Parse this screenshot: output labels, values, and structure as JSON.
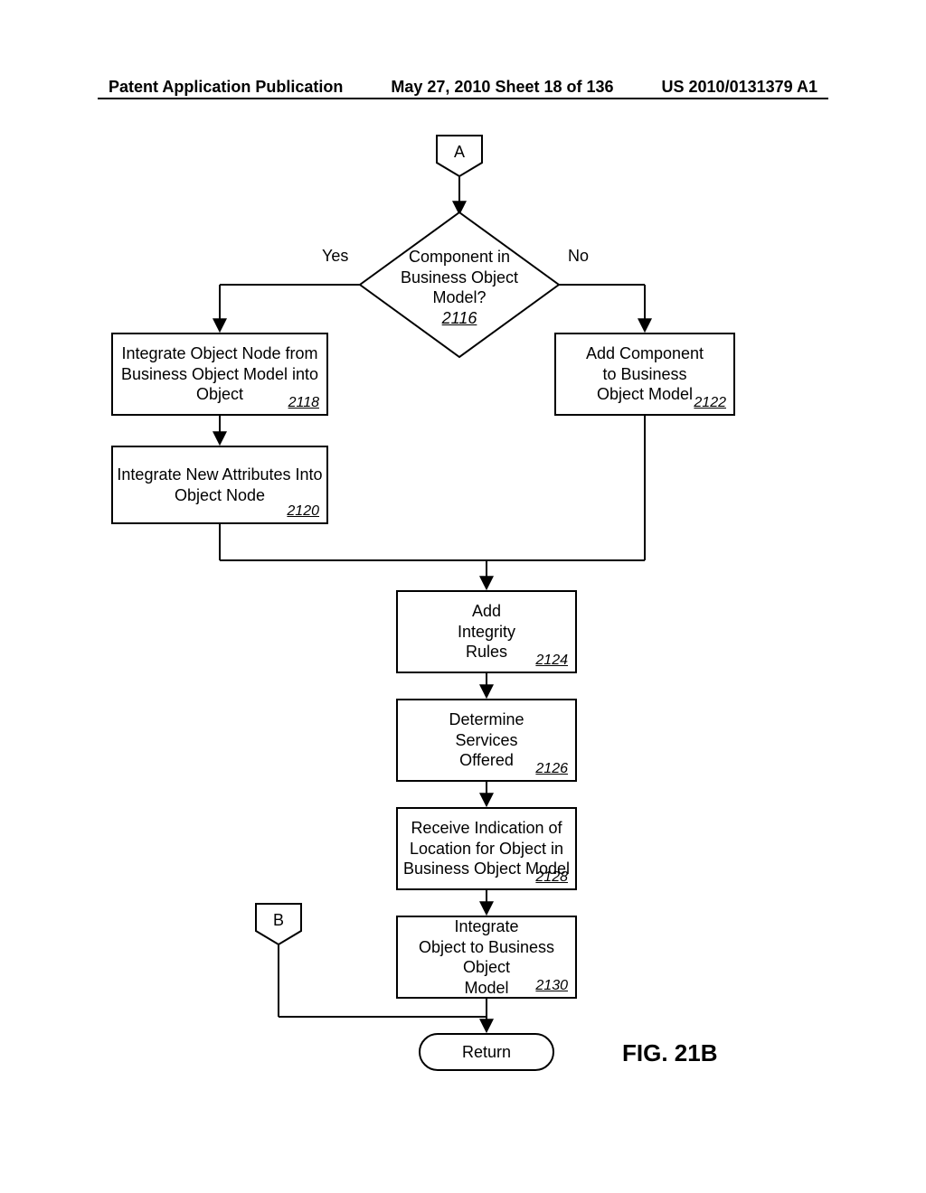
{
  "header": {
    "left": "Patent Application Publication",
    "center": "May 27, 2010  Sheet 18 of 136",
    "right": "US 2010/0131379 A1"
  },
  "figure_label": "FIG. 21B",
  "connectors": {
    "a": "A",
    "b": "B"
  },
  "decision": {
    "text_l1": "Component in",
    "text_l2": "Business Object",
    "text_l3": "Model?",
    "ref": "2116",
    "yes": "Yes",
    "no": "No"
  },
  "boxes": {
    "b2118": {
      "l1": "Integrate Object Node from",
      "l2": "Business Object Model into",
      "l3": "Object",
      "ref": "2118"
    },
    "b2120": {
      "l1": "Integrate New Attributes Into",
      "l2": "Object Node",
      "ref": "2120"
    },
    "b2122": {
      "l1": "Add Component",
      "l2": "to Business",
      "l3": "Object Model",
      "ref": "2122"
    },
    "b2124": {
      "l1": "Add",
      "l2": "Integrity",
      "l3": "Rules",
      "ref": "2124"
    },
    "b2126": {
      "l1": "Determine",
      "l2": "Services",
      "l3": "Offered",
      "ref": "2126"
    },
    "b2128": {
      "l1": "Receive Indication of",
      "l2": "Location for Object in",
      "l3": "Business Object Model",
      "ref": "2128"
    },
    "b2130": {
      "l1": "Integrate",
      "l2": "Object to Business Object",
      "l3": "Model",
      "ref": "2130"
    }
  },
  "return": "Return"
}
